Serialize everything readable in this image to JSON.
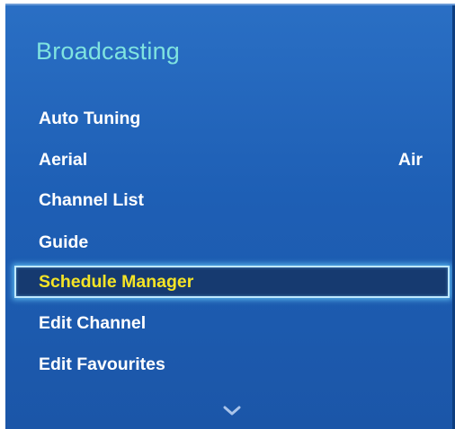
{
  "menu": {
    "title": "Broadcasting",
    "items": [
      {
        "label": "Auto Tuning",
        "value": ""
      },
      {
        "label": "Aerial",
        "value": "Air"
      },
      {
        "label": "Channel List",
        "value": ""
      },
      {
        "label": "Guide",
        "value": ""
      },
      {
        "label": "Schedule Manager",
        "value": ""
      },
      {
        "label": "Edit Channel",
        "value": ""
      },
      {
        "label": "Edit Favourites",
        "value": ""
      }
    ],
    "selected_index": 4,
    "more_icon": "chevron-down-icon"
  },
  "colors": {
    "panel_bg": "#1e5fb5",
    "title_text": "#7fe3e0",
    "selected_text": "#f4e426",
    "selected_bg": "#163a70",
    "selected_border": "#bfe9ff"
  }
}
